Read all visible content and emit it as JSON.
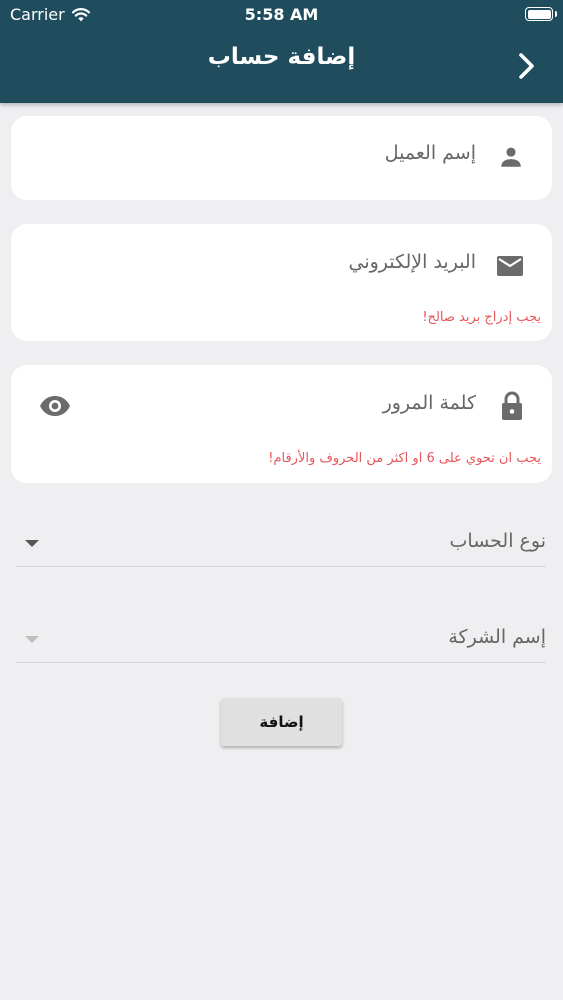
{
  "status_bar": {
    "carrier": "Carrier",
    "time": "5:58 AM"
  },
  "app_bar": {
    "title": "إضافة حساب",
    "background_color": "#1f4d5e"
  },
  "form": {
    "customer_name": {
      "placeholder": "إسم العميل",
      "value": "",
      "icon": "person-icon"
    },
    "email": {
      "placeholder": "البريد الإلكتروني",
      "value": "",
      "icon": "mail-icon",
      "error": "يجب إدراج بريد صالح!"
    },
    "password": {
      "placeholder": "كلمة المرور",
      "value": "",
      "icon": "lock-icon",
      "visibility_icon": "eye-icon",
      "error": "يجب ان تحوي على 6 او اكثر من الحروف والأرقام!"
    },
    "account_type": {
      "label": "نوع الحساب",
      "enabled": true
    },
    "company_name": {
      "label": "إسم الشركة",
      "enabled": false
    },
    "submit_label": "إضافة"
  },
  "colors": {
    "error": "#e5575a",
    "background": "#efeff1",
    "card": "#ffffff",
    "icon": "#6b6b6b"
  }
}
